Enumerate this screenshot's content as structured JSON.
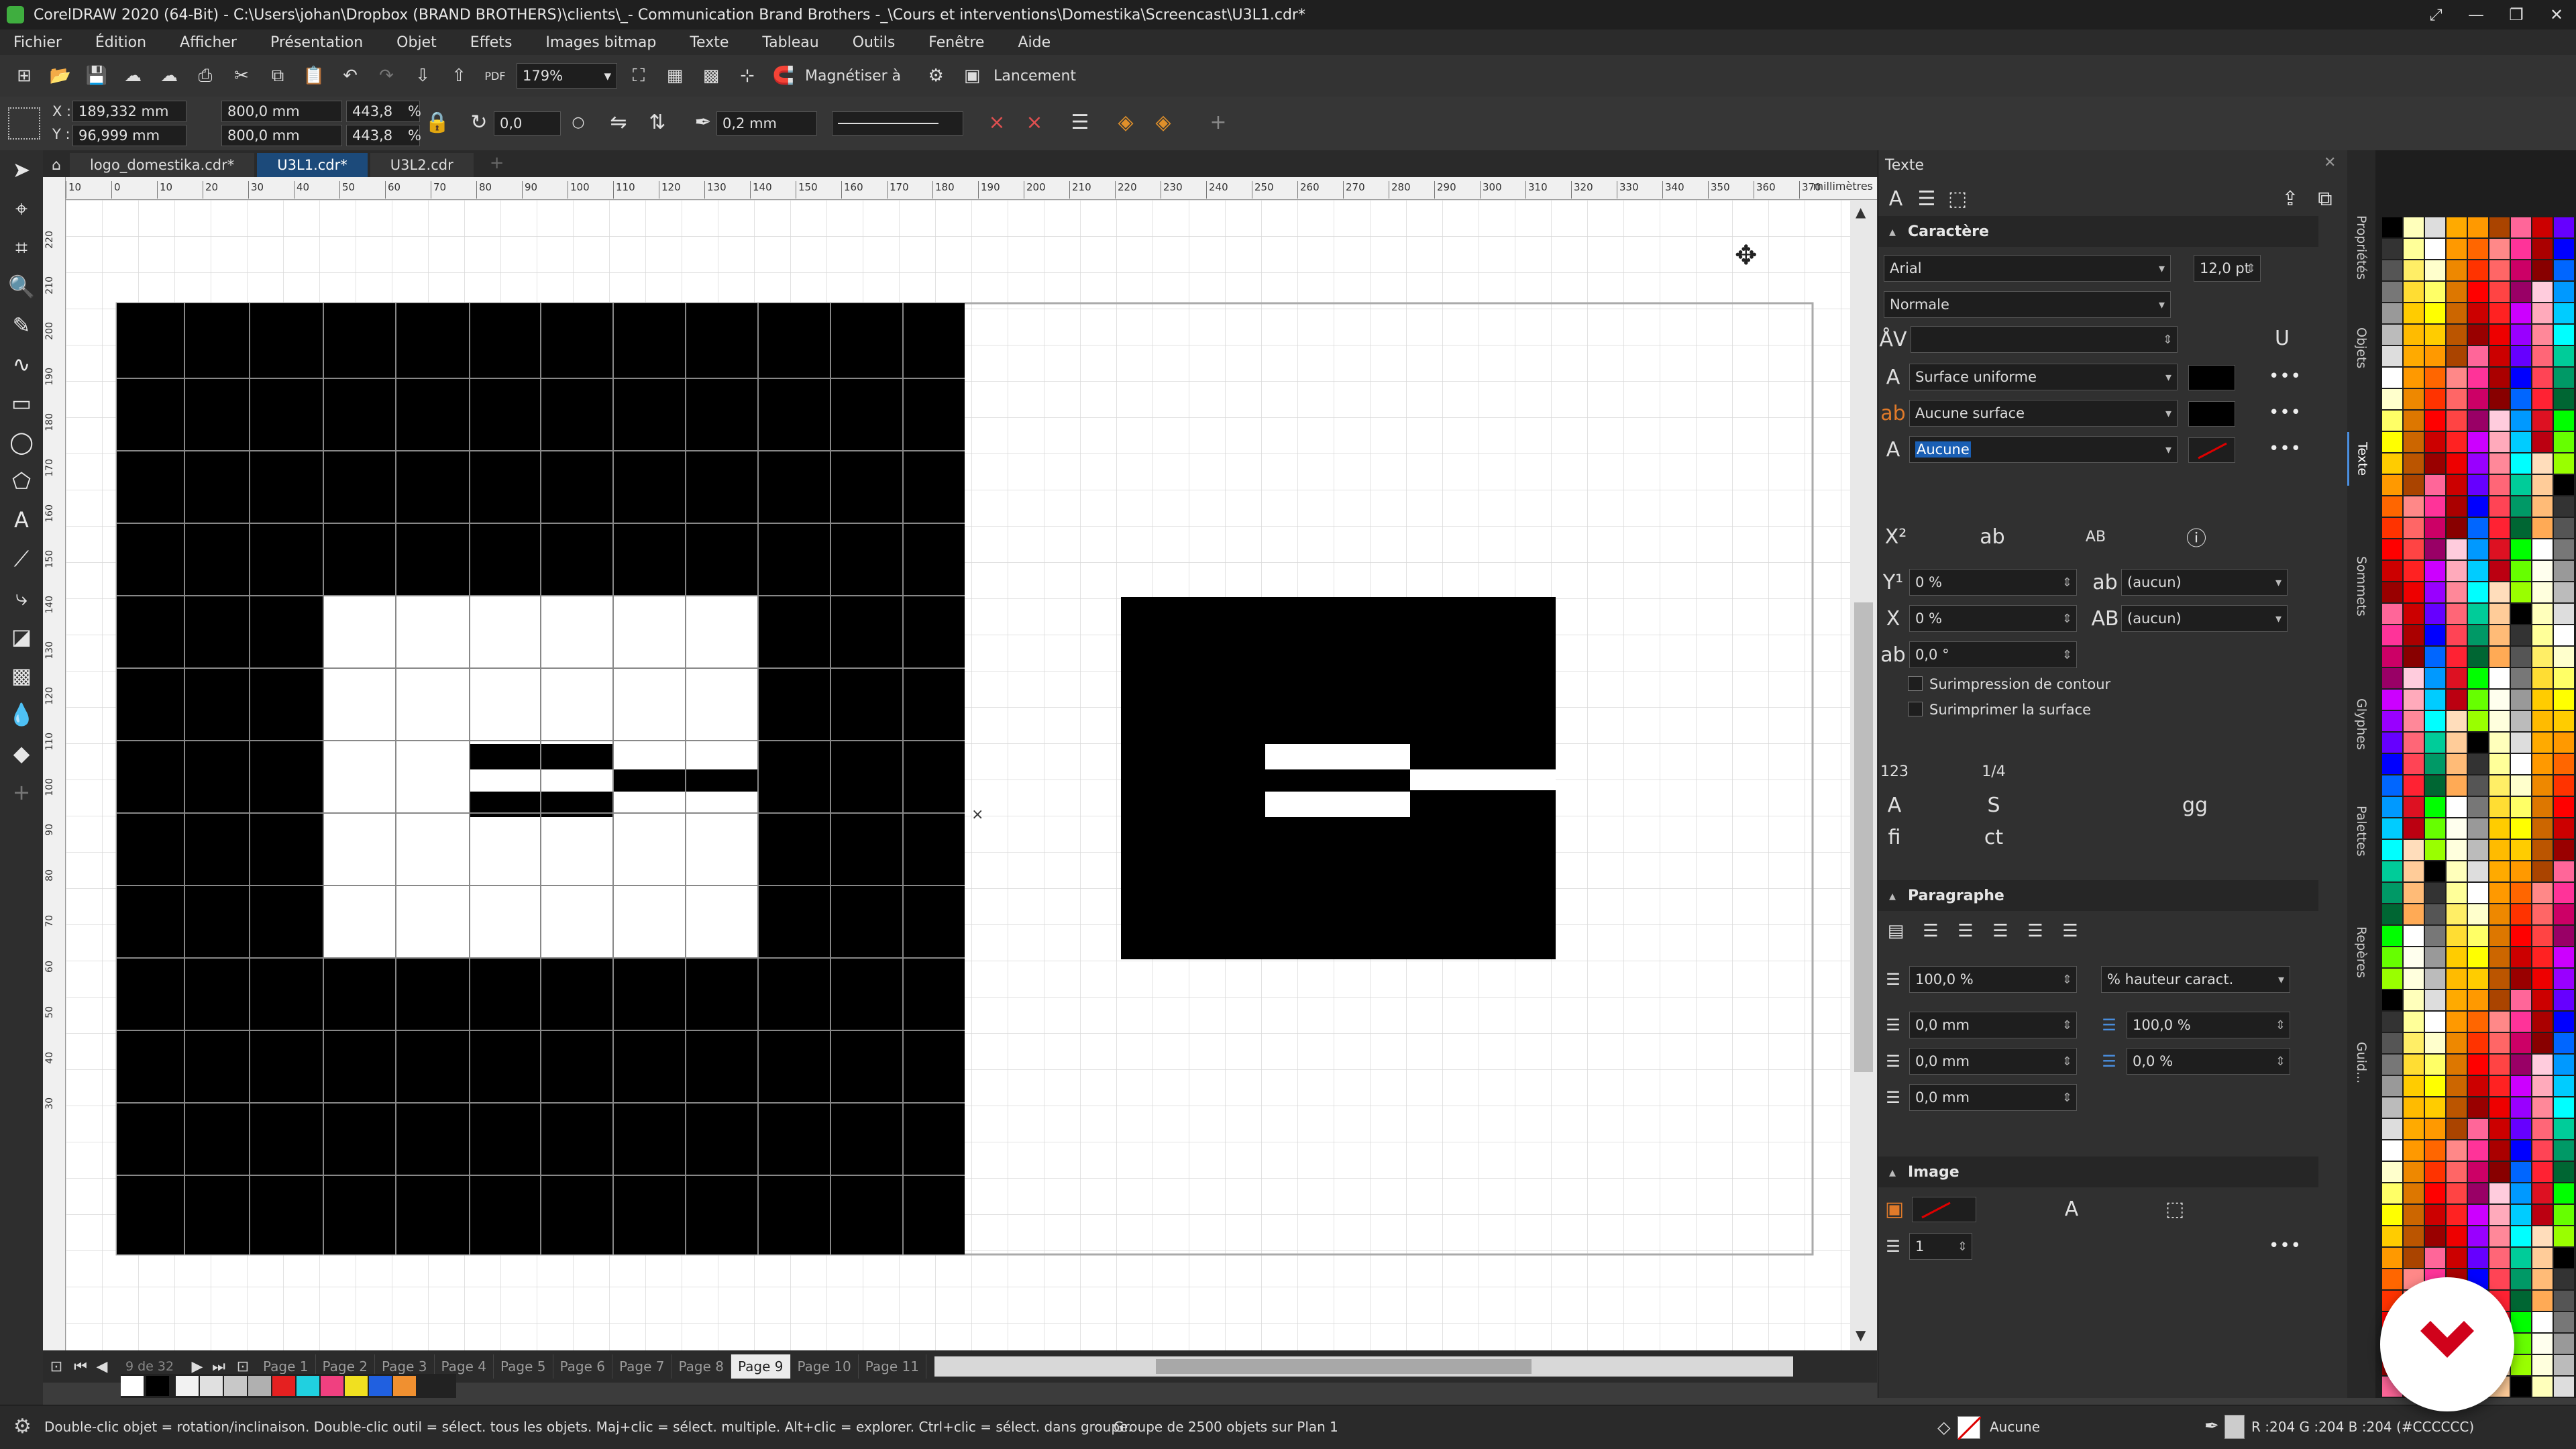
{
  "window": {
    "title": "CorelDRAW 2020 (64-Bit) - C:\\Users\\johan\\Dropbox (BRAND BROTHERS)\\clients\\_- Communication Brand Brothers -_\\Cours et interventions\\Domestika\\Screencast\\U3L1.cdr*",
    "controls": [
      "⤢",
      "—",
      "❐",
      "✕"
    ]
  },
  "menu": [
    "Fichier",
    "Édition",
    "Afficher",
    "Présentation",
    "Objet",
    "Effets",
    "Images bitmap",
    "Texte",
    "Tableau",
    "Outils",
    "Fenêtre",
    "Aide"
  ],
  "toolbar1": {
    "zoom": "179%",
    "snap": "Magnétiser à",
    "launch": "Lancement"
  },
  "toolbar2": {
    "x": "189,332 mm",
    "y": "96,999 mm",
    "w": "800,0 mm",
    "h": "800,0 mm",
    "sx": "443,8",
    "sy": "443,8",
    "pct": "%",
    "angle": "0,0",
    "outline": "0,2 mm",
    "x_label": "X :",
    "y_label": "Y :"
  },
  "tabs": [
    "logo_domestika.cdr*",
    "U3L1.cdr*",
    "U3L2.cdr"
  ],
  "ruler": {
    "unit": "millimètres",
    "h_ticks": [
      "10",
      "0",
      "10",
      "20",
      "30",
      "40",
      "50",
      "60",
      "70",
      "80",
      "90",
      "100",
      "110",
      "120",
      "130",
      "140",
      "150",
      "160",
      "170",
      "180",
      "190",
      "200",
      "210",
      "220",
      "230",
      "240",
      "250",
      "260",
      "270",
      "280",
      "290",
      "300",
      "310",
      "320",
      "330",
      "340",
      "350",
      "360",
      "370"
    ],
    "v_ticks": [
      "220",
      "210",
      "200",
      "190",
      "180",
      "170",
      "160",
      "150",
      "140",
      "130",
      "120",
      "110",
      "100",
      "90",
      "80",
      "70",
      "60",
      "50",
      "40",
      "30"
    ]
  },
  "pages": {
    "count_text": "9 de 32",
    "items": [
      "Page 1",
      "Page 2",
      "Page 3",
      "Page 4",
      "Page 5",
      "Page 6",
      "Page 7",
      "Page 8",
      "Page 9",
      "Page 10",
      "Page 11"
    ],
    "active": "Page 9"
  },
  "status": {
    "hint": "Double-clic objet = rotation/inclinaison. Double-clic outil = sélect. tous les objets. Maj+clic = sélect. multiple. Alt+clic = explorer. Ctrl+clic = sélect. dans groupe.",
    "selection": "Groupe de 2500 objets sur Plan 1",
    "outline": "Aucune",
    "color": "R :204 G :204 B :204 (#CCCCCC)"
  },
  "docker": {
    "title": "Texte",
    "character": {
      "heading": "Caractère",
      "font": "Arial",
      "size": "12,0 pt",
      "style": "Normale",
      "fill": "Surface uniforme",
      "bg": "Aucune surface",
      "outline": "Aucune",
      "y_offset": "0 %",
      "x_offset": "0 %",
      "rotation": "0,0 °",
      "underline_opt": "(aucun)",
      "caps_opt": "(aucun)",
      "overprint_outline": "Surimpression de contour",
      "overprint_fill": "Surimprimer la surface",
      "more": "•••"
    },
    "paragraph": {
      "heading": "Paragraphe",
      "line_spacing": "100,0 %",
      "spacing_unit": "% hauteur caract.",
      "indent_left": "0,0 mm",
      "indent_first": "0,0 mm",
      "indent_right": "0,0 mm",
      "char_spacing": "100,0 %",
      "word_spacing": "0,0 %"
    },
    "image": {
      "heading": "Image",
      "columns": "1",
      "more": "•••"
    }
  },
  "vtabs": [
    "Propriétés",
    "Objets",
    "Texte",
    "Sommets",
    "Glyphes",
    "Palettes",
    "Repères",
    "Guid..."
  ],
  "colors": {
    "accent": "#1c4a7a",
    "brand_red": "#d0021b",
    "page_bg": "#ffffff",
    "dark_ui": "#2b2b2b"
  }
}
